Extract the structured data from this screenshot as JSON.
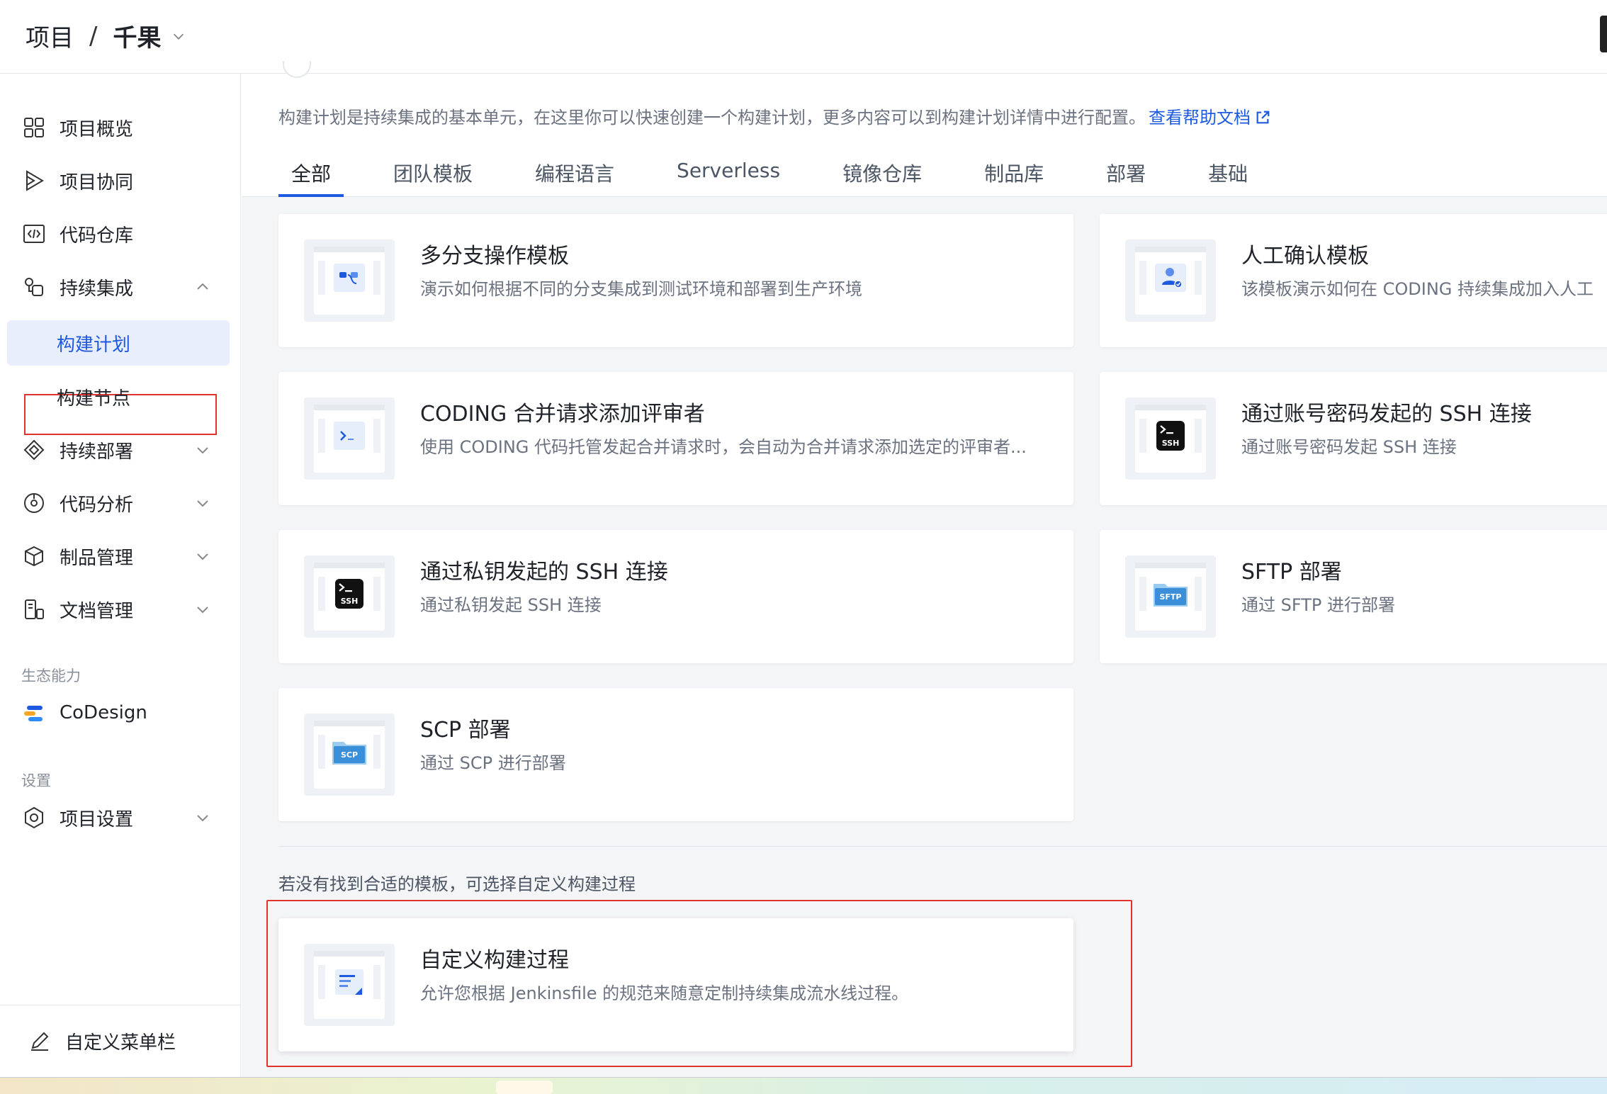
{
  "breadcrumb": {
    "section": "项目",
    "separator": "/",
    "project": "千果"
  },
  "sidebar": {
    "items": [
      {
        "label": "项目概览",
        "icon": "grid-icon"
      },
      {
        "label": "项目协同",
        "icon": "play-icon"
      },
      {
        "label": "代码仓库",
        "icon": "code-icon"
      },
      {
        "label": "持续集成",
        "icon": "ci-icon"
      },
      {
        "label": "持续部署",
        "icon": "deploy-icon"
      },
      {
        "label": "代码分析",
        "icon": "analysis-icon"
      },
      {
        "label": "制品管理",
        "icon": "package-icon"
      },
      {
        "label": "文档管理",
        "icon": "docs-icon"
      }
    ],
    "ci_subitems": [
      {
        "label": "构建计划",
        "active": true
      },
      {
        "label": "构建节点",
        "active": false
      }
    ],
    "ecosystem_label": "生态能力",
    "codesign_label": "CoDesign",
    "settings_label": "设置",
    "project_settings_label": "项目设置",
    "customize_menu_label": "自定义菜单栏"
  },
  "main": {
    "intro": "构建计划是持续集成的基本单元，在这里你可以快速创建一个构建计划，更多内容可以到构建计划详情中进行配置。",
    "help_link": "查看帮助文档",
    "tabs": [
      {
        "label": "全部",
        "active": true
      },
      {
        "label": "团队模板"
      },
      {
        "label": "编程语言"
      },
      {
        "label": "Serverless"
      },
      {
        "label": "镜像仓库"
      },
      {
        "label": "制品库"
      },
      {
        "label": "部署"
      },
      {
        "label": "基础"
      }
    ],
    "templates": [
      {
        "title": "多分支操作模板",
        "desc": "演示如何根据不同的分支集成到测试环境和部署到生产环境",
        "icon": "branch-icon"
      },
      {
        "title": "人工确认模板",
        "desc": "该模板演示如何在 CODING 持续集成加入人工",
        "icon": "user-check-icon"
      },
      {
        "title": "CODING 合并请求添加评审者",
        "desc": "使用 CODING 代码托管发起合并请求时，会自动为合并请求添加选定的评审者...",
        "icon": "terminal-icon"
      },
      {
        "title": "通过账号密码发起的 SSH 连接",
        "desc": "通过账号密码发起 SSH 连接",
        "icon": "ssh-icon"
      },
      {
        "title": "通过私钥发起的 SSH 连接",
        "desc": "通过私钥发起 SSH 连接",
        "icon": "ssh-icon"
      },
      {
        "title": "SFTP 部署",
        "desc": "通过 SFTP 进行部署",
        "icon": "sftp-folder-icon"
      },
      {
        "title": "SCP 部署",
        "desc": "通过 SCP 进行部署",
        "icon": "scp-folder-icon"
      }
    ],
    "custom_hint": "若没有找到合适的模板，可选择自定义构建过程",
    "custom_card": {
      "title": "自定义构建过程",
      "desc": "允许您根据 Jenkinsfile 的规范来随意定制持续集成流水线过程。",
      "icon": "document-edit-icon"
    },
    "ssh_badge": "SSH",
    "sftp_badge": "SFTP",
    "scp_badge": "SCP"
  },
  "colors": {
    "accent": "#1d5ae0",
    "highlight_box": "#e0342f",
    "active_bg": "#e8eefb"
  }
}
